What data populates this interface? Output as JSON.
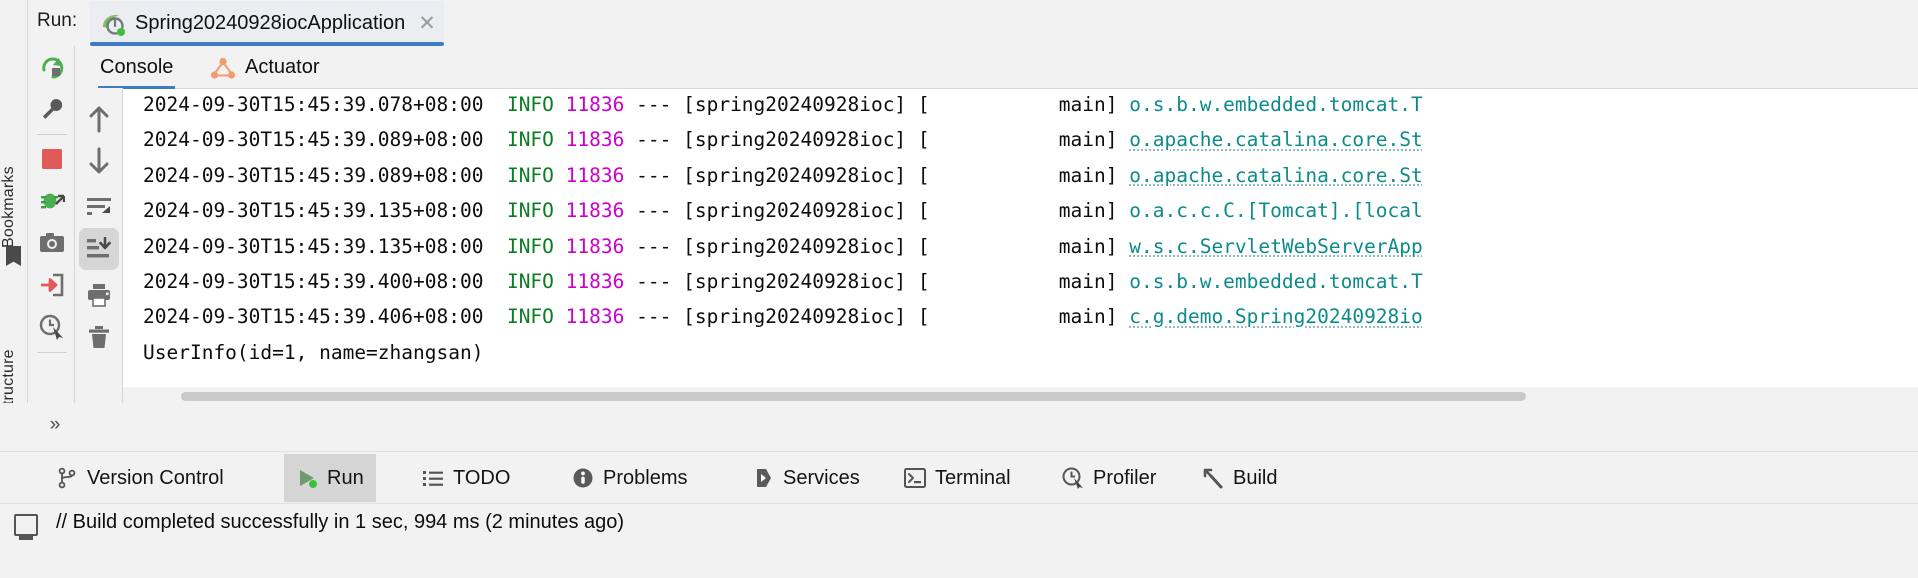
{
  "window": {
    "run_label": "Run:",
    "run_tab_title": "Spring20240928iocApplication",
    "run_tab_icon": "spring-boot-icon",
    "close_icon": "close-icon"
  },
  "left_strip": {
    "bookmarks_label": "Bookmarks",
    "structure_label": "Structure",
    "bookmark_icon": "bookmark-flag-icon",
    "grid_icon": "grid-dots-icon"
  },
  "run_toolbar": {
    "items": [
      {
        "name": "rerun-button",
        "icon": "rerun-icon",
        "tooltip": "Rerun"
      },
      {
        "name": "settings-button",
        "icon": "wrench-icon",
        "tooltip": "Modify Run Configuration"
      },
      {
        "name": "stop-button",
        "icon": "stop-square-icon",
        "tooltip": "Stop"
      },
      {
        "name": "debug-button",
        "icon": "bug-icon",
        "tooltip": "Attach Debugger"
      },
      {
        "name": "camera-button",
        "icon": "camera-icon",
        "tooltip": "Capture Memory Snapshot"
      },
      {
        "name": "import-button",
        "icon": "import-arrow-icon",
        "tooltip": "Open Dump"
      },
      {
        "name": "profiler-button",
        "icon": "clock-pointer-icon",
        "tooltip": "Profiler"
      }
    ]
  },
  "console_toolbar": {
    "items": [
      {
        "name": "scroll-up-button",
        "icon": "arrow-up-icon",
        "tooltip": "Up"
      },
      {
        "name": "scroll-down-button",
        "icon": "arrow-down-icon",
        "tooltip": "Down"
      },
      {
        "name": "soft-wrap-button",
        "icon": "soft-wrap-icon",
        "tooltip": "Soft-Wrap",
        "selected": false
      },
      {
        "name": "scroll-to-end-button",
        "icon": "scroll-to-end-icon",
        "tooltip": "Scroll to End",
        "selected": true
      },
      {
        "name": "print-button",
        "icon": "printer-icon",
        "tooltip": "Print"
      },
      {
        "name": "clear-button",
        "icon": "trash-icon",
        "tooltip": "Clear All"
      }
    ]
  },
  "console_tabs": [
    {
      "label": "Console",
      "icon": "console-icon",
      "active": true
    },
    {
      "label": "Actuator",
      "icon": "actuator-graph-icon",
      "active": false
    }
  ],
  "console": {
    "lines": [
      {
        "ts": "2024-09-30T15:45:39.078+08:00",
        "level": "INFO",
        "pid": "11836",
        "sep": "---",
        "app": "[spring20240928ioc]",
        "thread": "[           main]",
        "logger": "o.s.b.w.embedded.tomcat.T",
        "underline": false
      },
      {
        "ts": "2024-09-30T15:45:39.089+08:00",
        "level": "INFO",
        "pid": "11836",
        "sep": "---",
        "app": "[spring20240928ioc]",
        "thread": "[           main]",
        "logger": "o.apache.catalina.core.St",
        "underline": true
      },
      {
        "ts": "2024-09-30T15:45:39.089+08:00",
        "level": "INFO",
        "pid": "11836",
        "sep": "---",
        "app": "[spring20240928ioc]",
        "thread": "[           main]",
        "logger": "o.apache.catalina.core.St",
        "underline": true
      },
      {
        "ts": "2024-09-30T15:45:39.135+08:00",
        "level": "INFO",
        "pid": "11836",
        "sep": "---",
        "app": "[spring20240928ioc]",
        "thread": "[           main]",
        "logger": "o.a.c.c.C.[Tomcat].[local",
        "underline": false
      },
      {
        "ts": "2024-09-30T15:45:39.135+08:00",
        "level": "INFO",
        "pid": "11836",
        "sep": "---",
        "app": "[spring20240928ioc]",
        "thread": "[           main]",
        "logger": "w.s.c.ServletWebServerApp",
        "underline": true
      },
      {
        "ts": "2024-09-30T15:45:39.400+08:00",
        "level": "INFO",
        "pid": "11836",
        "sep": "---",
        "app": "[spring20240928ioc]",
        "thread": "[           main]",
        "logger": "o.s.b.w.embedded.tomcat.T",
        "underline": false
      },
      {
        "ts": "2024-09-30T15:45:39.406+08:00",
        "level": "INFO",
        "pid": "11836",
        "sep": "---",
        "app": "[spring20240928ioc]",
        "thread": "[           main]",
        "logger": "c.g.demo.Spring20240928io",
        "underline": true
      }
    ],
    "plain_output": "UserInfo(id=1, name=zhangsan)"
  },
  "tool_windows": [
    {
      "label": "Version Control",
      "icon": "branch-icon",
      "active": false
    },
    {
      "label": "Run",
      "icon": "run-play-icon",
      "active": true
    },
    {
      "label": "TODO",
      "icon": "todo-list-icon",
      "active": false
    },
    {
      "label": "Problems",
      "icon": "problems-icon",
      "active": false
    },
    {
      "label": "Services",
      "icon": "services-icon",
      "active": false
    },
    {
      "label": "Terminal",
      "icon": "terminal-icon",
      "active": false
    },
    {
      "label": "Profiler",
      "icon": "profiler-clock-icon",
      "active": false
    },
    {
      "label": "Build",
      "icon": "build-hammer-icon",
      "active": false
    }
  ],
  "status": {
    "icon": "build-status-icon",
    "message": "// Build completed successfully in 1 sec, 994 ms (2 minutes ago)"
  },
  "colors": {
    "accent_blue": "#3e7cc4",
    "info_green": "#0b7d21",
    "pid_magenta": "#cc00cc",
    "logger_teal": "#0d8b8b",
    "panel_bg": "#f2f2f2",
    "console_bg": "#ffffff"
  }
}
